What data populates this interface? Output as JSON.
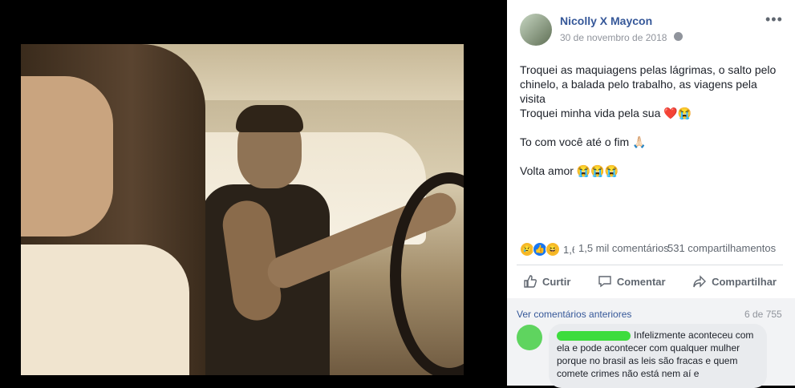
{
  "post": {
    "author": "Nicolly X Maycon",
    "date": "30 de novembro de 2018",
    "menu_glyph": "•••",
    "text_lines": [
      "Troquei as maquiagens pelas lágrimas, o salto pelo chinelo, a balada pelo trabalho, as viagens pela visita",
      "Troquei minha vida pela sua ❤️😭",
      "",
      "To com você até o fim 🙏🏻",
      "",
      "Volta amor 😭😭😭"
    ]
  },
  "stats": {
    "reaction_icons": [
      "sad-icon",
      "like-icon",
      "haha-icon"
    ],
    "reaction_count": "1,6",
    "comments": "1,5 mil comentários",
    "shares": "531 compartilhamentos"
  },
  "actions": {
    "like_label": "Curtir",
    "comment_label": "Comentar",
    "share_label": "Compartilhar"
  },
  "comments": {
    "previous_link": "Ver comentários anteriores",
    "page_count": "6 de 755",
    "first": {
      "text": "Infelizmente aconteceu com ela e pode acontecer com qualquer mulher porque no brasil as leis são fracas e quem comete crimes não está nem aí e"
    }
  },
  "colors": {
    "link": "#365899",
    "redaction": "#3ddc3d",
    "like_blue": "#1877f2"
  }
}
